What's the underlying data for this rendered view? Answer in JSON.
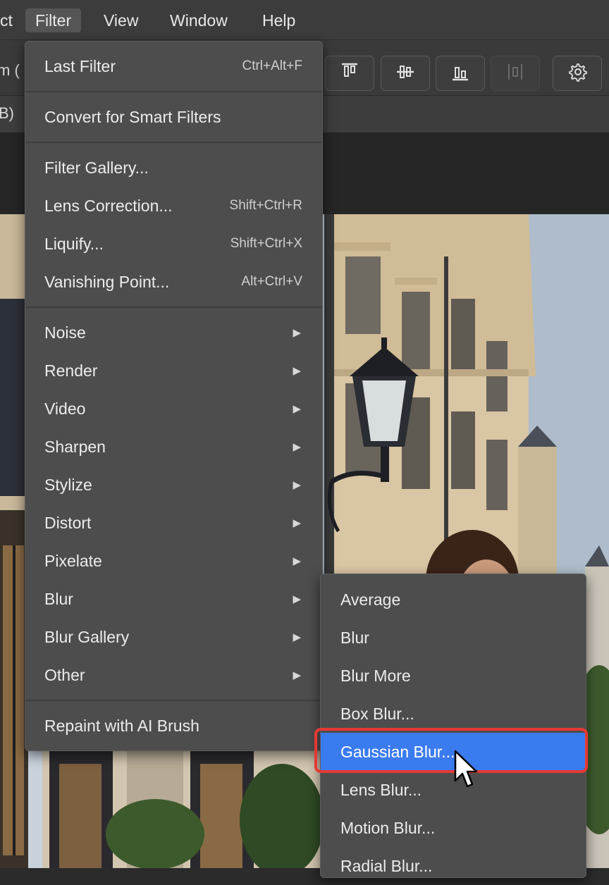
{
  "menubar": {
    "items": [
      {
        "label": "ct"
      },
      {
        "label": "Filter"
      },
      {
        "label": "View"
      },
      {
        "label": "Window"
      },
      {
        "label": "Help"
      }
    ]
  },
  "options_bar": {
    "left_text": "m ("
  },
  "tab_bar": {
    "left_text": "B)"
  },
  "toolbar_icons": [
    "align-top-icon",
    "align-vertical-center-icon",
    "align-bottom-icon",
    "distribute-icon",
    "gear-icon"
  ],
  "filter_menu": {
    "last_filter": {
      "label": "Last Filter",
      "shortcut": "Ctrl+Alt+F"
    },
    "convert_smart": {
      "label": "Convert for Smart Filters"
    },
    "filter_gallery": {
      "label": "Filter Gallery..."
    },
    "lens_correction": {
      "label": "Lens Correction...",
      "shortcut": "Shift+Ctrl+R"
    },
    "liquify": {
      "label": "Liquify...",
      "shortcut": "Shift+Ctrl+X"
    },
    "vanishing_point": {
      "label": "Vanishing Point...",
      "shortcut": "Alt+Ctrl+V"
    },
    "submenus": [
      {
        "label": "Noise"
      },
      {
        "label": "Render"
      },
      {
        "label": "Video"
      },
      {
        "label": "Sharpen"
      },
      {
        "label": "Stylize"
      },
      {
        "label": "Distort"
      },
      {
        "label": "Pixelate"
      },
      {
        "label": "Blur"
      },
      {
        "label": "Blur Gallery"
      },
      {
        "label": "Other"
      }
    ],
    "repaint": {
      "label": "Repaint with AI Brush"
    },
    "arrow": "▶"
  },
  "blur_submenu": {
    "items": [
      {
        "label": "Average"
      },
      {
        "label": "Blur"
      },
      {
        "label": "Blur More"
      },
      {
        "label": "Box Blur..."
      },
      {
        "label": "Gaussian Blur..."
      },
      {
        "label": "Lens Blur..."
      },
      {
        "label": "Motion Blur..."
      },
      {
        "label": "Radial Blur..."
      }
    ],
    "highlighted": "Gaussian Blur...",
    "highlight_color": "#3b7bf0"
  },
  "colors": {
    "menu_bg": "#4d4d4d",
    "menubar_bg": "#3c3c3c",
    "highlight": "#3b7bf0",
    "focus_ring": "#e53935"
  }
}
